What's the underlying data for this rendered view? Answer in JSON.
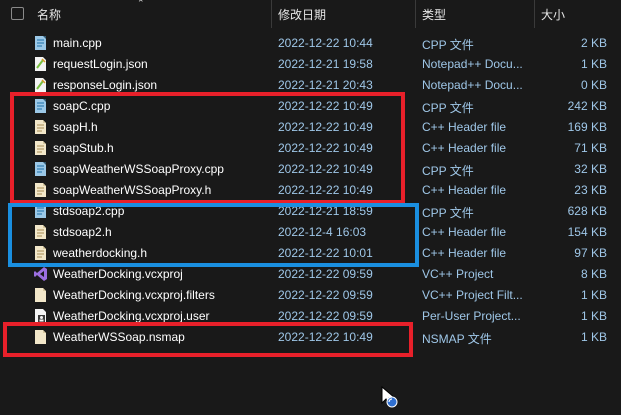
{
  "header": {
    "name": "名称",
    "modified": "修改日期",
    "type": "类型",
    "size": "大小"
  },
  "files": [
    {
      "name": "main.cpp",
      "date": "2022-12-22 10:44",
      "type": "CPP 文件",
      "size": "2 KB",
      "icon": "cpp-file-icon"
    },
    {
      "name": "requestLogin.json",
      "date": "2022-12-21 19:58",
      "type": "Notepad++ Docu...",
      "size": "1 KB",
      "icon": "notepadpp-file-icon"
    },
    {
      "name": "responseLogin.json",
      "date": "2022-12-21 20:43",
      "type": "Notepad++ Docu...",
      "size": "0 KB",
      "icon": "notepadpp-file-icon"
    },
    {
      "name": "soapC.cpp",
      "date": "2022-12-22 10:49",
      "type": "CPP 文件",
      "size": "242 KB",
      "icon": "cpp-file-icon"
    },
    {
      "name": "soapH.h",
      "date": "2022-12-22 10:49",
      "type": "C++ Header file",
      "size": "169 KB",
      "icon": "header-file-icon"
    },
    {
      "name": "soapStub.h",
      "date": "2022-12-22 10:49",
      "type": "C++ Header file",
      "size": "71 KB",
      "icon": "header-file-icon"
    },
    {
      "name": "soapWeatherWSSoapProxy.cpp",
      "date": "2022-12-22 10:49",
      "type": "CPP 文件",
      "size": "32 KB",
      "icon": "cpp-file-icon"
    },
    {
      "name": "soapWeatherWSSoapProxy.h",
      "date": "2022-12-22 10:49",
      "type": "C++ Header file",
      "size": "23 KB",
      "icon": "header-file-icon"
    },
    {
      "name": "stdsoap2.cpp",
      "date": "2022-12-21 18:59",
      "type": "CPP 文件",
      "size": "628 KB",
      "icon": "cpp-file-icon"
    },
    {
      "name": "stdsoap2.h",
      "date": "2022-12-4 16:03",
      "type": "C++ Header file",
      "size": "154 KB",
      "icon": "header-file-icon"
    },
    {
      "name": "weatherdocking.h",
      "date": "2022-12-22 10:01",
      "type": "C++ Header file",
      "size": "97 KB",
      "icon": "header-file-icon"
    },
    {
      "name": "WeatherDocking.vcxproj",
      "date": "2022-12-22 09:59",
      "type": "VC++ Project",
      "size": "8 KB",
      "icon": "visual-studio-icon"
    },
    {
      "name": "WeatherDocking.vcxproj.filters",
      "date": "2022-12-22 09:59",
      "type": "VC++ Project Filt...",
      "size": "1 KB",
      "icon": "generic-file-icon"
    },
    {
      "name": "WeatherDocking.vcxproj.user",
      "date": "2022-12-22 09:59",
      "type": "Per-User Project...",
      "size": "1 KB",
      "icon": "user-file-icon"
    },
    {
      "name": "WeatherWSSoap.nsmap",
      "date": "2022-12-22 10:49",
      "type": "NSMAP 文件",
      "size": "1 KB",
      "icon": "generic-file-icon"
    }
  ],
  "colors": {
    "background": "#191919",
    "date_text": "#9fc7e8",
    "highlight_red": "#e8202a",
    "highlight_blue": "#1a8fe0"
  }
}
